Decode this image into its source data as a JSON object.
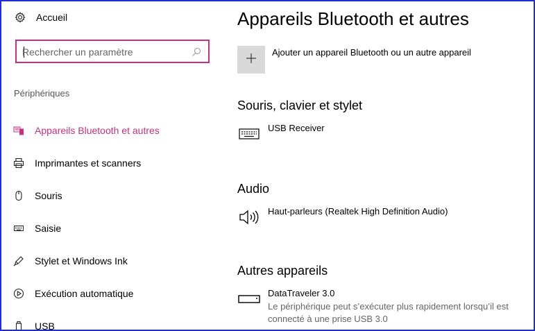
{
  "sidebar": {
    "home_label": "Accueil",
    "search_placeholder": "Rechercher un paramètre",
    "section_title": "Périphériques",
    "items": [
      {
        "label": "Appareils Bluetooth et autres",
        "icon": "bluetooth-devices-icon",
        "active": true
      },
      {
        "label": "Imprimantes et scanners",
        "icon": "printer-icon",
        "active": false
      },
      {
        "label": "Souris",
        "icon": "mouse-icon",
        "active": false
      },
      {
        "label": "Saisie",
        "icon": "keyboard-icon",
        "active": false
      },
      {
        "label": "Stylet et Windows Ink",
        "icon": "pen-icon",
        "active": false
      },
      {
        "label": "Exécution automatique",
        "icon": "autoplay-icon",
        "active": false
      },
      {
        "label": "USB",
        "icon": "usb-icon",
        "active": false
      }
    ]
  },
  "main": {
    "title": "Appareils Bluetooth et autres",
    "add_device_label": "Ajouter un appareil Bluetooth ou un autre appareil",
    "groups": [
      {
        "title": "Souris, clavier et stylet",
        "devices": [
          {
            "name": "USB Receiver",
            "description": "",
            "icon": "keyboard-icon"
          }
        ]
      },
      {
        "title": "Audio",
        "devices": [
          {
            "name": "Haut-parleurs (Realtek High Definition Audio)",
            "description": "",
            "icon": "speaker-icon"
          }
        ]
      },
      {
        "title": "Autres appareils",
        "devices": [
          {
            "name": "DataTraveler 3.0",
            "description": "Le périphérique peut s’exécuter plus rapidement lorsqu’il est connecté à une prise USB 3.0",
            "icon": "usb-drive-icon"
          }
        ]
      }
    ]
  },
  "colors": {
    "accent": "#c8307f",
    "frame_border": "#1f2bd6",
    "add_tile_bg": "#d9d9d9"
  }
}
